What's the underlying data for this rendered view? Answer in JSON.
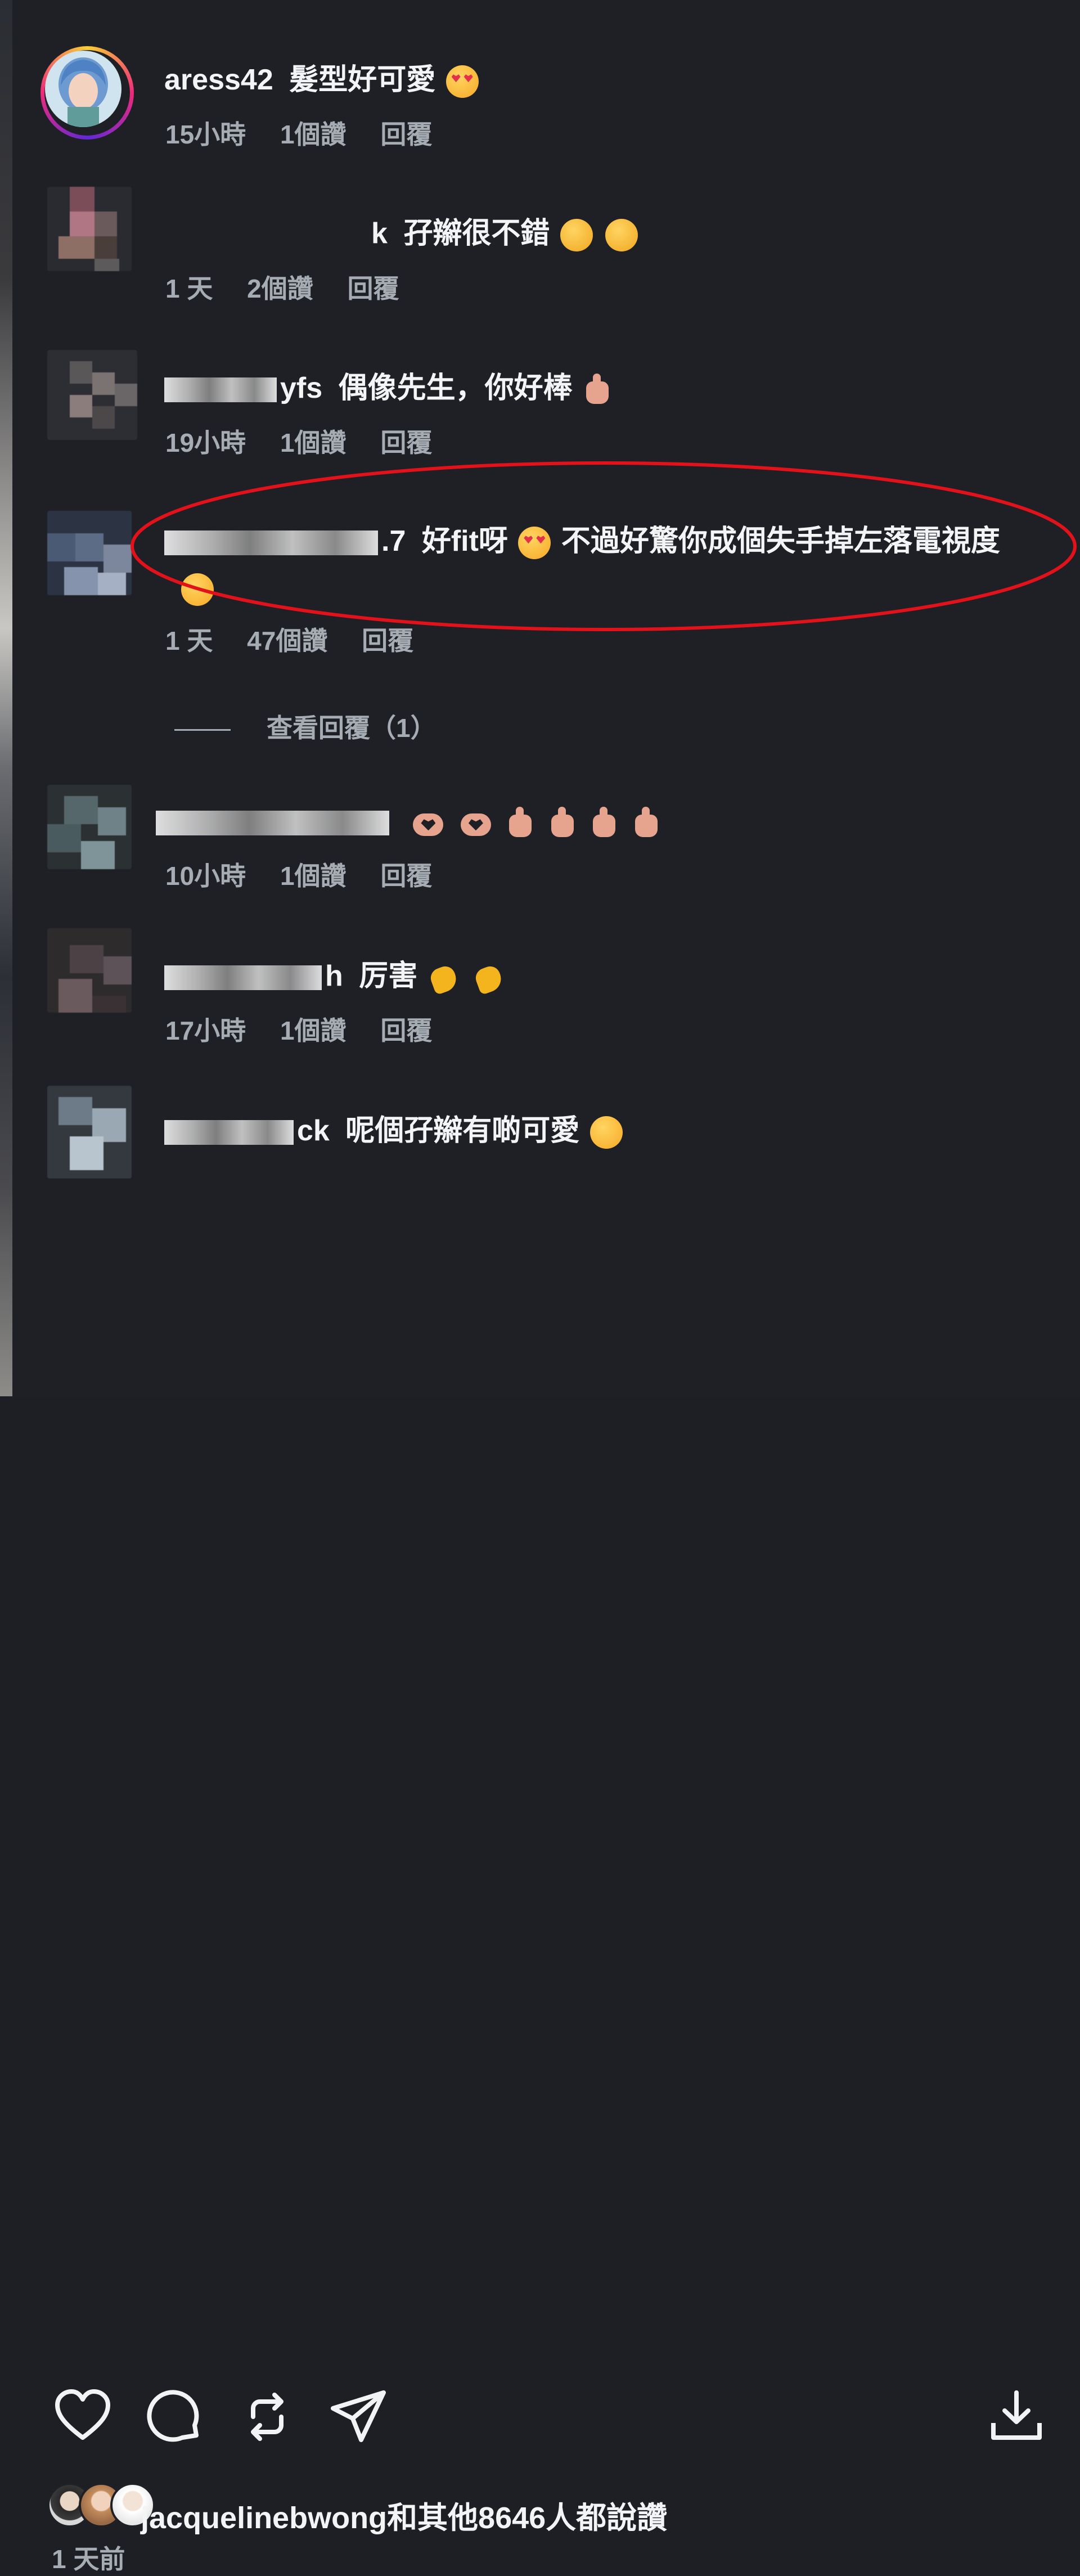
{
  "comments": [
    {
      "user": "aress42",
      "text": "髮型好可愛",
      "emojis": [
        "star-struck"
      ],
      "time": "15小時",
      "likes": "1個讚",
      "reply": "回覆"
    },
    {
      "user": "k",
      "text": "孖辮很不錯",
      "emojis": [
        "hand-over-mouth",
        "shushing"
      ],
      "time": "1 天",
      "likes": "2個讚",
      "reply": "回覆"
    },
    {
      "user": "yfs",
      "text": "偶像先生，你好棒",
      "emojis": [
        "thumbs-up"
      ],
      "time": "19小時",
      "likes": "1個讚",
      "reply": "回覆"
    },
    {
      "user": ".7",
      "text": "好fit呀",
      "text2": "不過好驚你成個失手掉左落電視度",
      "emojis": [
        "star-struck",
        "laughing"
      ],
      "time": "1 天",
      "likes": "47個讚",
      "reply": "回覆",
      "view_replies": "查看回覆（1）"
    },
    {
      "user": "",
      "text": "",
      "emojis": [
        "heart-hands",
        "heart-hands",
        "thumbs-up",
        "thumbs-up",
        "thumbs-up",
        "thumbs-up"
      ],
      "time": "10小時",
      "likes": "1個讚",
      "reply": "回覆"
    },
    {
      "user": "h",
      "text": "厉害",
      "emojis": [
        "clapping",
        "clapping"
      ],
      "time": "17小時",
      "likes": "1個讚",
      "reply": "回覆"
    },
    {
      "user": "ck",
      "text": "呢個孖辮有啲可愛",
      "emojis": [
        "rofl"
      ]
    }
  ],
  "actions": {
    "icons": [
      "heart-icon",
      "comment-icon",
      "repost-icon",
      "share-icon",
      "download-icon"
    ]
  },
  "likes_summary": "jacquelinebwong和其他8646人都說讚",
  "time_ago": "1 天前",
  "colors": {
    "background": "#1e2025",
    "highlight": "#e3121a",
    "meta": "#a6acb3"
  }
}
